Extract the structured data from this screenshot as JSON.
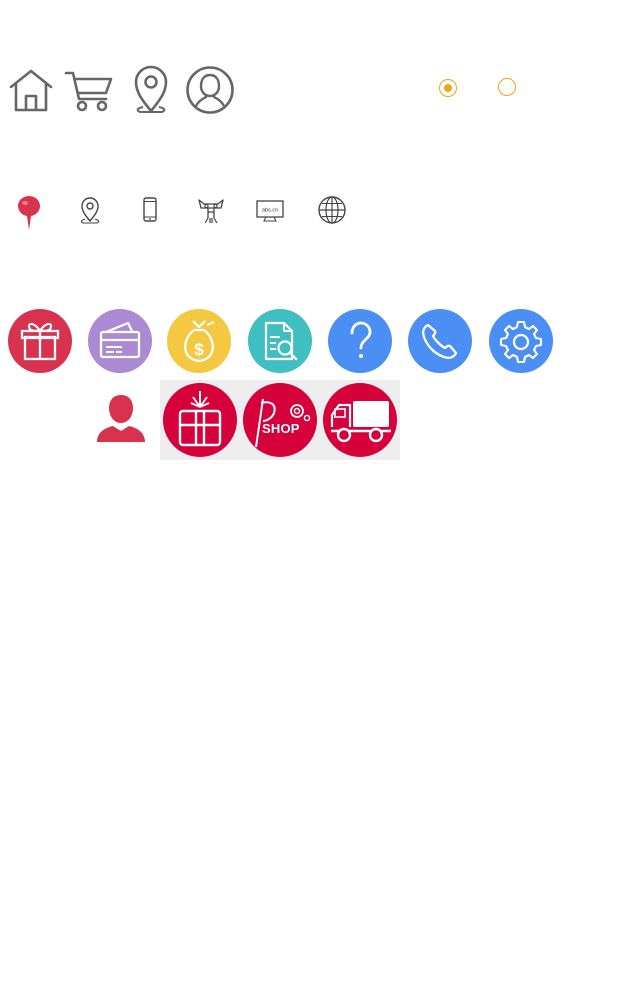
{
  "radios": [
    {
      "state": "selected",
      "color": "#f2a31b"
    },
    {
      "state": "unselected",
      "color": "#f2a31b"
    }
  ],
  "icons": {
    "row1": [
      "home-icon",
      "cart-icon",
      "location-pin-outline-icon",
      "user-circle-icon"
    ],
    "row2": [
      "location-pin-filled-icon",
      "location-pin-thin-icon",
      "mobile-phone-icon",
      "cartoon-character-icon",
      "monitor-domain-icon",
      "globe-icon"
    ],
    "row3": [
      "gift-icon",
      "credit-card-icon",
      "money-bag-icon",
      "document-search-icon",
      "help-question-icon",
      "phone-icon",
      "settings-gear-icon"
    ],
    "row4": [
      "user-silhouette-icon",
      "gift-box-icon",
      "shop-icon",
      "delivery-truck-icon"
    ]
  },
  "labels": {
    "domain_text": "abs.cn",
    "shop_text": "SHOP"
  },
  "colors": {
    "gray_icon": "#666666",
    "red": "#d9324f",
    "crimson": "#d6003a",
    "purple": "#a98ad3",
    "yellow": "#f5c842",
    "teal": "#3fbfbf",
    "blue": "#4b8ff5",
    "accent_orange": "#f2a31b"
  }
}
